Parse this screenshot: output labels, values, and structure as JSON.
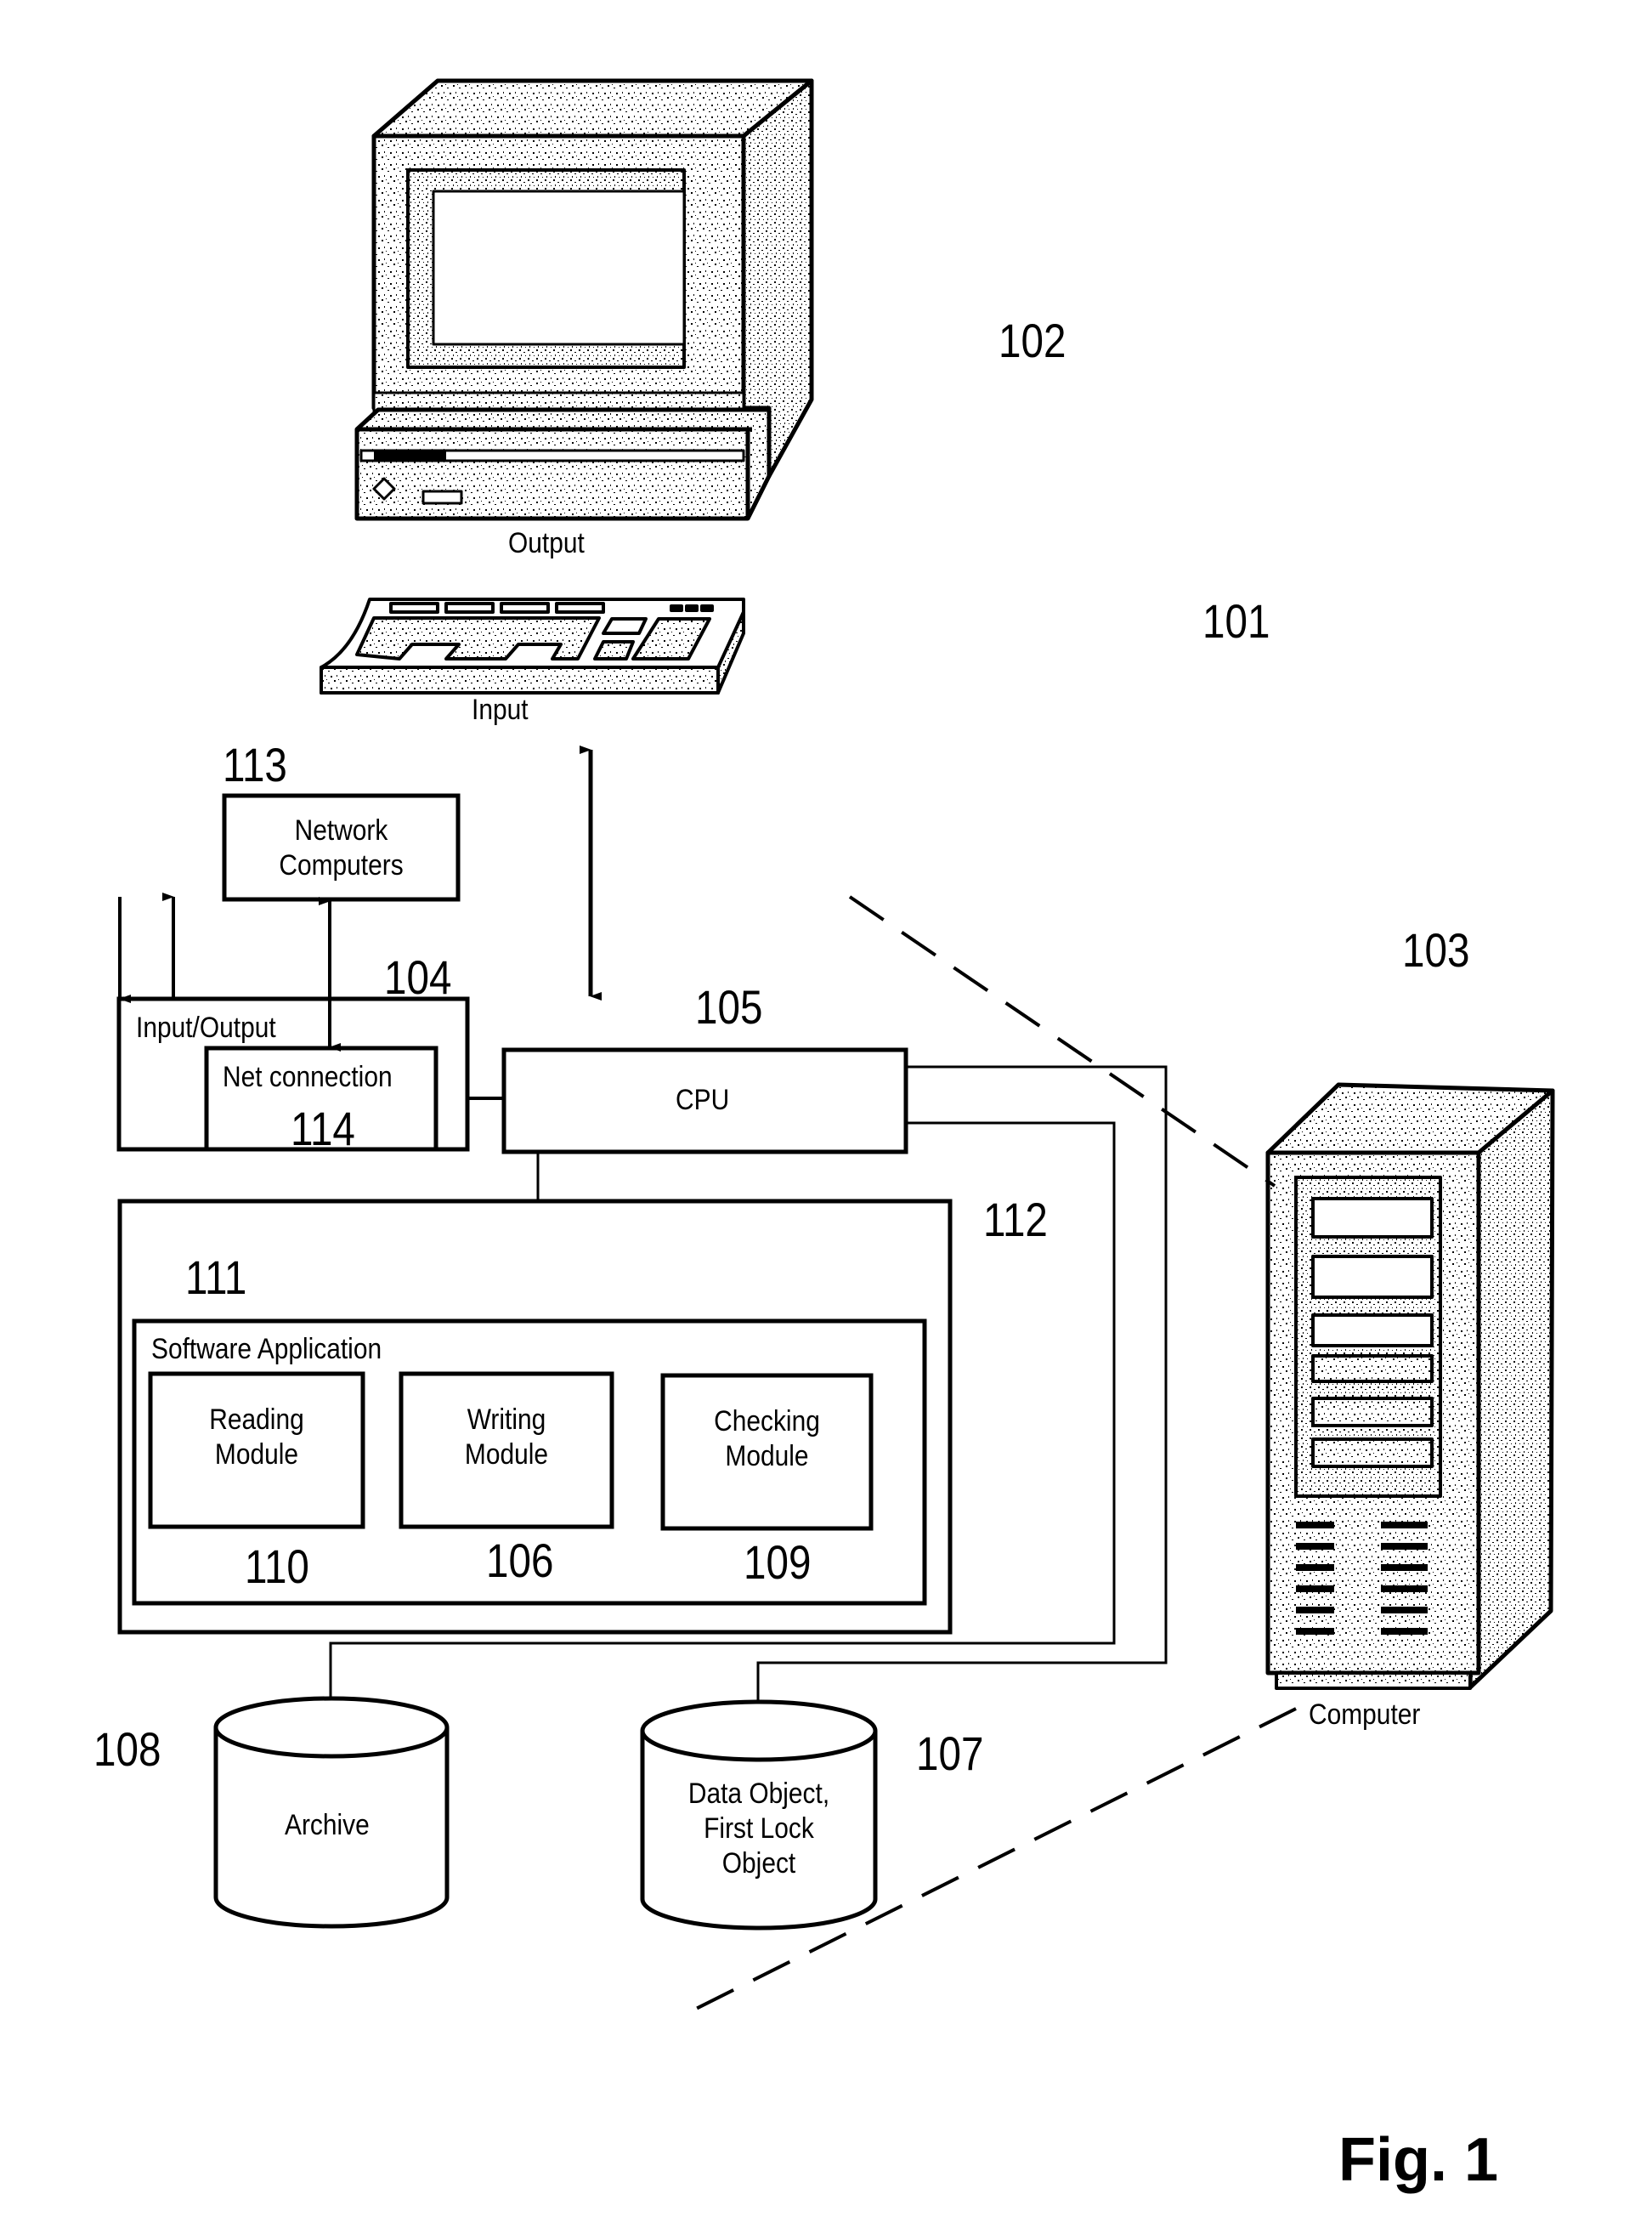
{
  "figure": {
    "title": "Fig. 1",
    "system_ref": "101"
  },
  "devices": {
    "monitor": {
      "ref": "102",
      "label": "Output",
      "icon": "monitor-icon"
    },
    "keyboard": {
      "label": "Input",
      "icon": "keyboard-icon"
    },
    "tower": {
      "ref": "103",
      "label": "Computer",
      "icon": "server-tower-icon"
    }
  },
  "blocks": {
    "network_computers": {
      "ref": "113",
      "label": "Network Computers"
    },
    "input_output": {
      "ref": "104",
      "label": "Input/Output"
    },
    "net_connection": {
      "ref": "114",
      "label": "Net connection"
    },
    "cpu": {
      "ref": "105",
      "label": "CPU"
    },
    "memory": {
      "ref": "112"
    },
    "software_application": {
      "ref": "111",
      "label": "Software Application"
    },
    "modules": [
      {
        "ref": "110",
        "label_line1": "Reading",
        "label_line2": "Module"
      },
      {
        "ref": "106",
        "label_line1": "Writing",
        "label_line2": "Module"
      },
      {
        "ref": "109",
        "label_line1": "Checking",
        "label_line2": "Module"
      }
    ]
  },
  "storage": {
    "archive": {
      "ref": "108",
      "label": "Archive"
    },
    "data_object": {
      "ref": "107",
      "line1": "Data Object,",
      "line2": "First Lock",
      "line3": "Object"
    }
  }
}
